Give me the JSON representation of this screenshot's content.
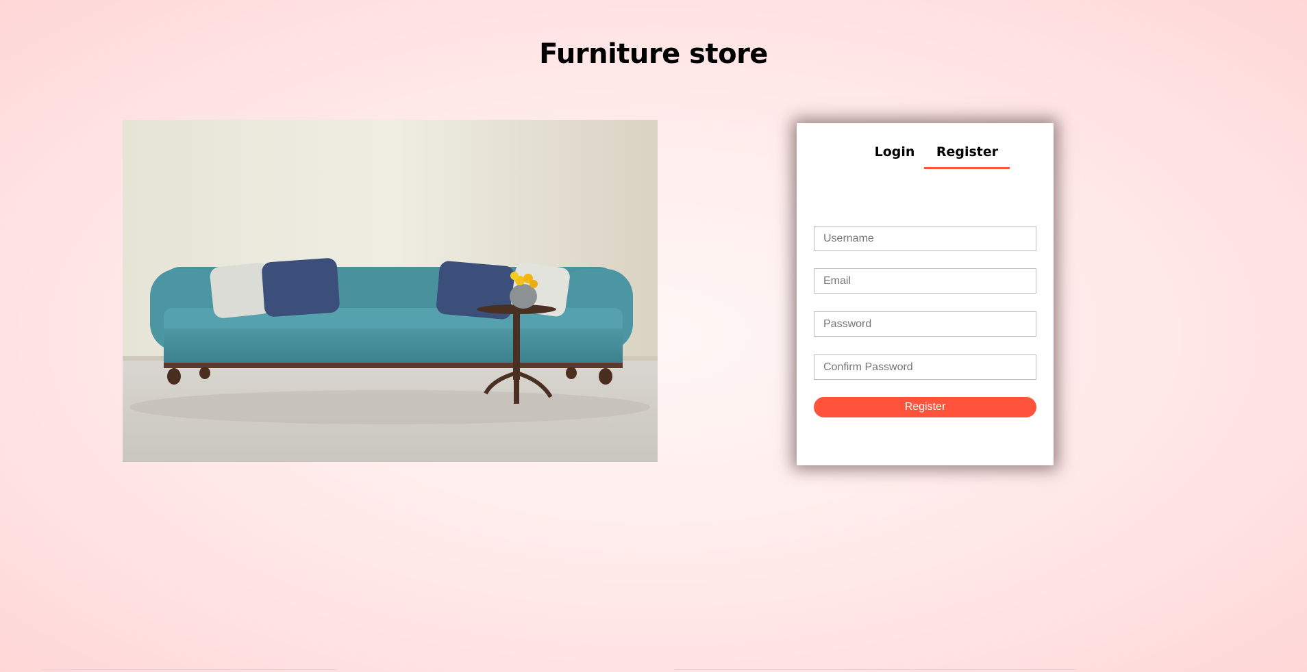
{
  "header": {
    "title": "Furniture store"
  },
  "hero": {
    "image_description": "sofa-photo"
  },
  "auth": {
    "tabs": [
      {
        "label": "Login",
        "active": false
      },
      {
        "label": "Register",
        "active": true
      }
    ],
    "fields": {
      "username": {
        "value": "",
        "placeholder": "Username"
      },
      "email": {
        "value": "",
        "placeholder": "Email"
      },
      "password": {
        "value": "",
        "placeholder": "Password"
      },
      "confirm_password": {
        "value": "",
        "placeholder": "Confirm Password"
      }
    },
    "submit_label": "Register"
  },
  "colors": {
    "accent": "#ff533b",
    "background": "#ffe3e3",
    "card": "#ffffff"
  }
}
